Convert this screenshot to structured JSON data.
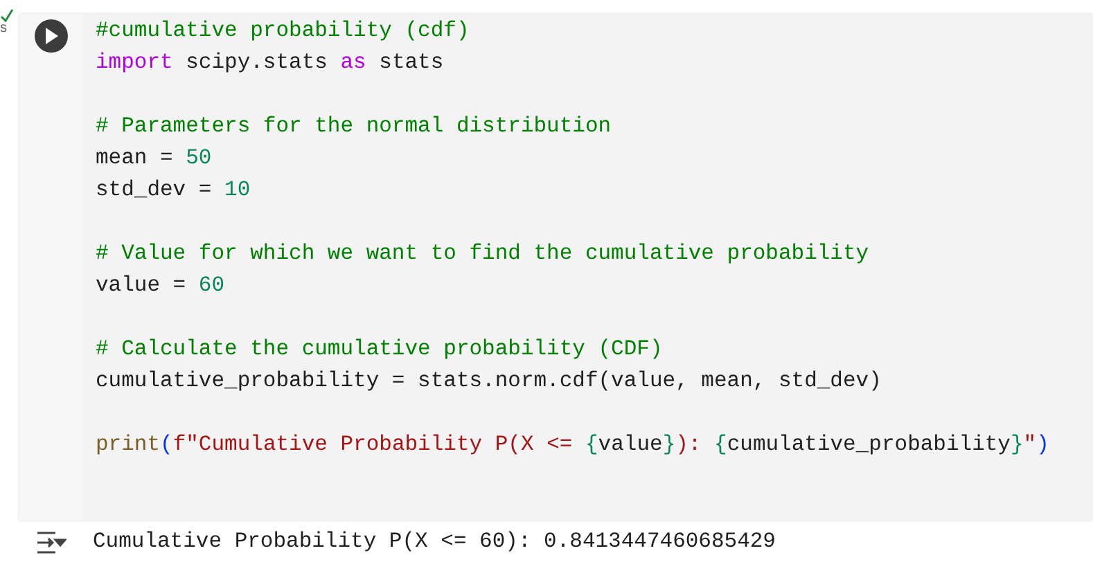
{
  "cell_status": {
    "time": "s"
  },
  "code_lines": [
    {
      "kind": "code",
      "tokens": [
        {
          "kind": "comment",
          "text": "#cumulative probability (cdf)"
        }
      ]
    },
    {
      "kind": "code",
      "tokens": [
        {
          "kind": "keyword",
          "text": "import"
        },
        {
          "kind": "plain",
          "text": " scipy.stats "
        },
        {
          "kind": "keyword",
          "text": "as"
        },
        {
          "kind": "plain",
          "text": " stats"
        }
      ]
    },
    {
      "kind": "blank"
    },
    {
      "kind": "code",
      "tokens": [
        {
          "kind": "comment",
          "text": "# Parameters for the normal distribution"
        }
      ]
    },
    {
      "kind": "code",
      "tokens": [
        {
          "kind": "plain",
          "text": "mean = "
        },
        {
          "kind": "number",
          "text": "50"
        }
      ]
    },
    {
      "kind": "code",
      "tokens": [
        {
          "kind": "plain",
          "text": "std_dev = "
        },
        {
          "kind": "number",
          "text": "10"
        }
      ]
    },
    {
      "kind": "blank"
    },
    {
      "kind": "code",
      "tokens": [
        {
          "kind": "comment",
          "text": "# Value for which we want to find the cumulative probability"
        }
      ]
    },
    {
      "kind": "code",
      "tokens": [
        {
          "kind": "plain",
          "text": "value = "
        },
        {
          "kind": "number",
          "text": "60"
        }
      ]
    },
    {
      "kind": "blank"
    },
    {
      "kind": "code",
      "tokens": [
        {
          "kind": "comment",
          "text": "# Calculate the cumulative probability (CDF)"
        }
      ]
    },
    {
      "kind": "code",
      "tokens": [
        {
          "kind": "plain",
          "text": "cumulative_probability = stats.norm.cdf(value, mean, std_dev)"
        }
      ]
    },
    {
      "kind": "blank"
    },
    {
      "kind": "code",
      "tokens": [
        {
          "kind": "function",
          "text": "print"
        },
        {
          "kind": "bracket",
          "text": "("
        },
        {
          "kind": "string",
          "text": "f\"Cumulative Probability P(X <= "
        },
        {
          "kind": "brace",
          "text": "{"
        },
        {
          "kind": "plain",
          "text": "value"
        },
        {
          "kind": "brace",
          "text": "}"
        },
        {
          "kind": "string",
          "text": "): "
        },
        {
          "kind": "brace",
          "text": "{"
        },
        {
          "kind": "plain",
          "text": "cumulative_probability"
        },
        {
          "kind": "brace",
          "text": "}"
        },
        {
          "kind": "string",
          "text": "\""
        },
        {
          "kind": "bracket",
          "text": ")"
        }
      ]
    }
  ],
  "output": "Cumulative Probability P(X <= 60): 0.8413447460685429"
}
